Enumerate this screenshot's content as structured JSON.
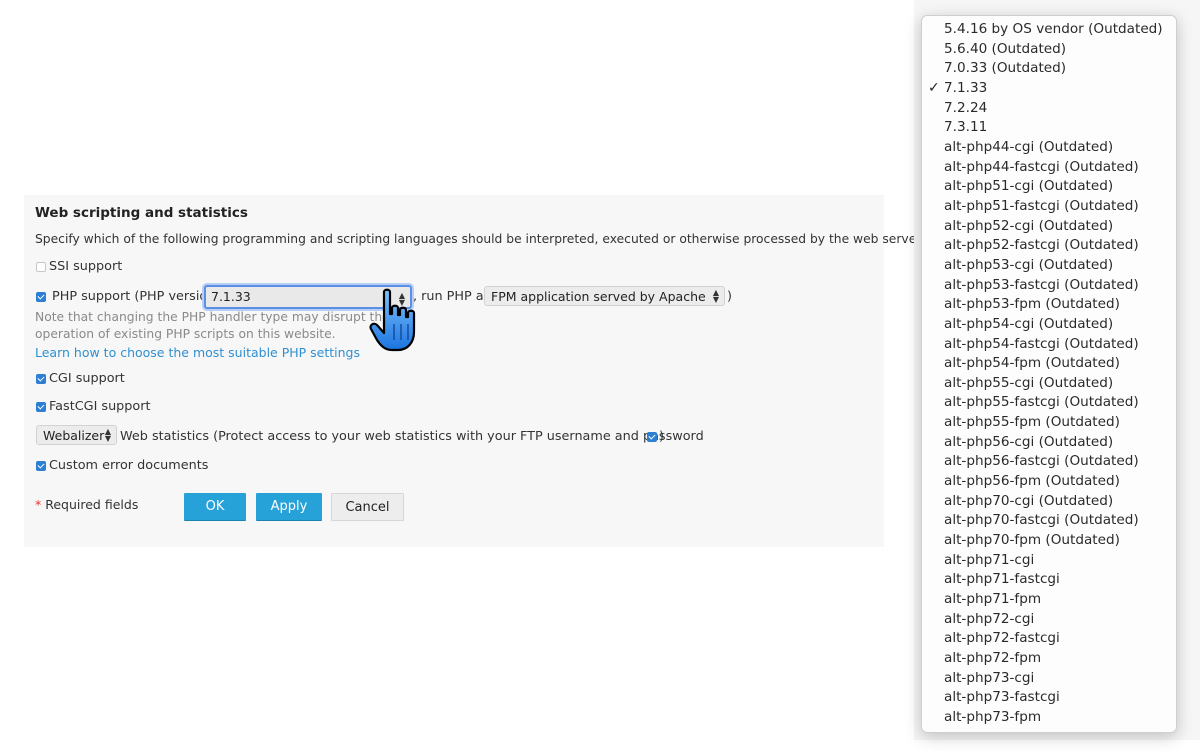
{
  "section": {
    "title": "Web scripting and statistics",
    "description": "Specify which of the following programming and scripting languages should be interpreted, executed or otherwise processed by the web server."
  },
  "ssi": {
    "label": "SSI support",
    "checked": false
  },
  "php": {
    "label": "PHP support (PHP version",
    "version_value": "7.1.33",
    "run_as_label": ", run PHP as",
    "handler_value": "FPM application served by Apache",
    "close_paren": ")",
    "note_line1": "Note that changing the PHP handler type may disrupt the",
    "note_line2": "operation of existing PHP scripts on this website.",
    "learn_link": "Learn how to choose the most suitable PHP settings",
    "checked": true
  },
  "cgi": {
    "label": "CGI support",
    "checked": true
  },
  "fastcgi": {
    "label": "FastCGI support",
    "checked": true
  },
  "stats": {
    "select_value": "Webalizer",
    "label": "Web statistics (Protect access to your web statistics with your FTP username and password",
    "close_paren": ")",
    "protect_checked": true
  },
  "error_docs": {
    "label": "Custom error documents",
    "checked": true
  },
  "form": {
    "required_star": "*",
    "required_text": "Required fields",
    "ok_label": "OK",
    "apply_label": "Apply",
    "cancel_label": "Cancel"
  },
  "colors": {
    "primary_button": "#27a2d8",
    "checkbox": "#2d7fd4",
    "link": "#2f8fd0",
    "focus_ring": "#5b8fe6"
  },
  "version_dropdown": {
    "selected": "7.1.33",
    "check_glyph": "✓",
    "options": [
      "5.4.16 by OS vendor (Outdated)",
      "5.6.40 (Outdated)",
      "7.0.33 (Outdated)",
      "7.1.33",
      "7.2.24",
      "7.3.11",
      "alt-php44-cgi (Outdated)",
      "alt-php44-fastcgi (Outdated)",
      "alt-php51-cgi (Outdated)",
      "alt-php51-fastcgi (Outdated)",
      "alt-php52-cgi (Outdated)",
      "alt-php52-fastcgi (Outdated)",
      "alt-php53-cgi (Outdated)",
      "alt-php53-fastcgi (Outdated)",
      "alt-php53-fpm (Outdated)",
      "alt-php54-cgi (Outdated)",
      "alt-php54-fastcgi (Outdated)",
      "alt-php54-fpm (Outdated)",
      "alt-php55-cgi (Outdated)",
      "alt-php55-fastcgi (Outdated)",
      "alt-php55-fpm (Outdated)",
      "alt-php56-cgi (Outdated)",
      "alt-php56-fastcgi (Outdated)",
      "alt-php56-fpm (Outdated)",
      "alt-php70-cgi (Outdated)",
      "alt-php70-fastcgi (Outdated)",
      "alt-php70-fpm (Outdated)",
      "alt-php71-cgi",
      "alt-php71-fastcgi",
      "alt-php71-fpm",
      "alt-php72-cgi",
      "alt-php72-fastcgi",
      "alt-php72-fpm",
      "alt-php73-cgi",
      "alt-php73-fastcgi",
      "alt-php73-fpm"
    ]
  }
}
